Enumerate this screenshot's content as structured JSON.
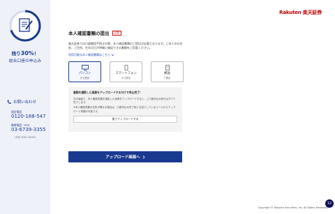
{
  "colors": {
    "brand": "#bf0000",
    "primary": "#1a3a8f",
    "sidebar_bg": "#eef1f8"
  },
  "sidebar": {
    "progress_icon": "document-pen-icon",
    "remaining_prefix": "残り",
    "remaining_value": "30%",
    "remaining_suffix": "！",
    "subtitle": "総合口座の申込み",
    "contact_icon": "phone-icon",
    "contact_label": "お問い合わせ",
    "fixed_label": "固定電話",
    "fixed_number": "0120-188-547",
    "mobile_label": "携帯電話・PHS",
    "mobile_number": "03-6739-3355",
    "hours": "(平日 8:00-18:00)"
  },
  "header": {
    "logo": "Rakuten 楽天証券"
  },
  "main": {
    "title": "本人確認書類の提出",
    "badge": "必須",
    "description": "楽天証券では口座開設手続きの際、本人確認書類のご提出が必要となります。ご本人のお名前、ご住所、生年月日が明確に確認できる書類をご用意ください。",
    "link_text": "利用可能な本人確認書類はこちら",
    "link_icon": "chevron-down-icon",
    "methods": [
      {
        "label": "パソコン",
        "sub": "から提出",
        "icon": "monitor-icon",
        "selected": true
      },
      {
        "label": "スマートフォン",
        "sub": "から提出",
        "icon": "smartphone-icon",
        "selected": false
      },
      {
        "label": "郵送",
        "sub": "で提出",
        "icon": "mail-icon",
        "selected": false
      }
    ],
    "info": {
      "heading": "書類を撮影した画像をアップロードするだけで申込完了！",
      "p1": "次の画面で、本人確認書類を撮影した画像をアップロードすると、ご口座申込手続きはすべて完了します。",
      "p2": "※本人確認書類の住所が異なる場合は、口座申込み完了後にお送りしているメールからアップロード再開が可能です。",
      "button": "後でアップロードする"
    },
    "upload_button": "アップロード画面へ",
    "upload_icon": "chevron-right-icon"
  },
  "footer": {
    "copyright": "Copyright © Rakuten Securities, Inc. All Rights Reserved.",
    "page_badge": "12"
  }
}
